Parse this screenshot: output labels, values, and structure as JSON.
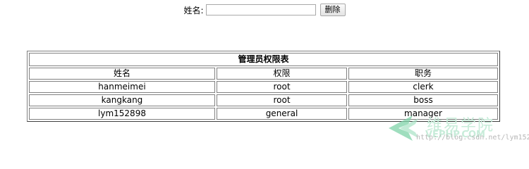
{
  "search": {
    "label": "姓名:",
    "input_value": "",
    "delete_button": "删除"
  },
  "table": {
    "caption": "管理员权限表",
    "headers": [
      "姓名",
      "权限",
      "职务"
    ],
    "rows": [
      [
        "hanmeimei",
        "root",
        "clerk"
      ],
      [
        "kangkang",
        "root",
        "boss"
      ],
      [
        "lym152898",
        "general",
        "manager"
      ]
    ]
  },
  "watermark": {
    "brand_cn": "维易学院",
    "brand_en": "VEPHP.COM",
    "url": "http://blog.csdn.net/lym152898",
    "color": "#c7ecd9"
  }
}
